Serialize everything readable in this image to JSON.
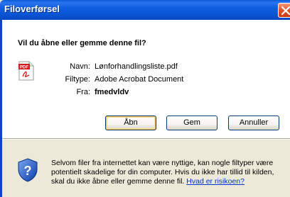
{
  "window": {
    "title": "Filoverførsel",
    "close_symbol": "×"
  },
  "dialog": {
    "question": "Vil du åbne eller gemme denne fil?",
    "file": {
      "icon": "pdf-icon",
      "icon_text": "PDF",
      "name_label": "Navn:",
      "name_value": "Lønforhandlingsliste.pdf",
      "type_label": "Filtype:",
      "type_value": "Adobe Acrobat Document",
      "from_label": "Fra:",
      "from_value": "fmedvldv"
    },
    "buttons": {
      "open": "Åbn",
      "save": "Gem",
      "cancel": "Annuller"
    },
    "warning": {
      "icon": "shield-question-icon",
      "text": "Selvom filer fra internettet kan være nyttige, kan nogle filtyper være potentielt skadelige for din computer. Hvis du ikke har tillid til kilden, skal du ikke åbne eller gemme denne fil.",
      "link": "Hvad er risikoen?"
    }
  },
  "colors": {
    "titlebar": "#0a56d6",
    "dialog_bg": "#ece9d8",
    "link": "#0033cc",
    "close_button": "#e0522c"
  }
}
